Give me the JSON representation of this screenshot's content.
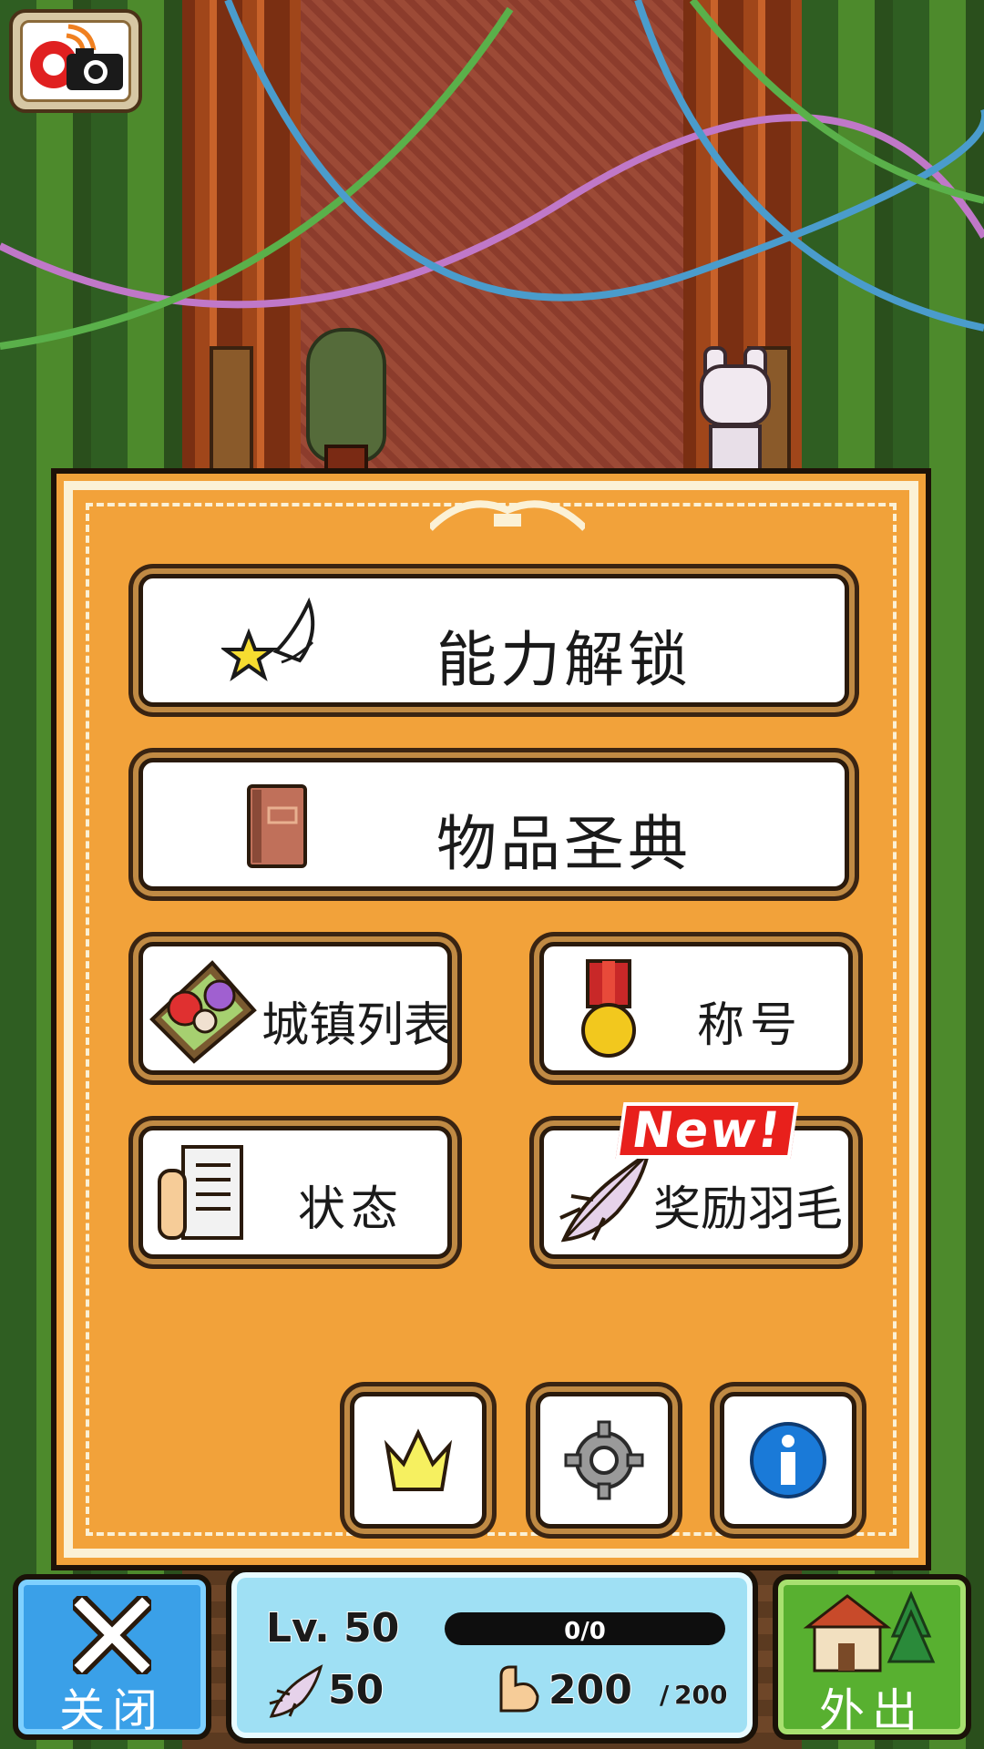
{
  "menu": {
    "ability_unlock": "能力解锁",
    "item_encyclopedia": "物品圣典",
    "town_list": "城镇列表",
    "titles": "称号",
    "status": "状态",
    "reward_feathers": "奖励羽毛",
    "new_badge": "New!"
  },
  "icon_buttons": [
    "crown-icon",
    "gear-icon",
    "info-icon"
  ],
  "bottom_bar": {
    "close_label": "关闭",
    "outing_label": "外出",
    "level": "Lv. 50",
    "exp_text": "0/0",
    "exp_progress": 0,
    "feathers": "50",
    "stamina": "200",
    "stamina_separator": "/",
    "stamina_max": "200"
  },
  "colors": {
    "panel": "#f2a23a",
    "close_button": "#3aa0e8",
    "outing_button": "#58b030",
    "status_panel": "#9fe0f4",
    "new_badge": "#e8201c"
  }
}
